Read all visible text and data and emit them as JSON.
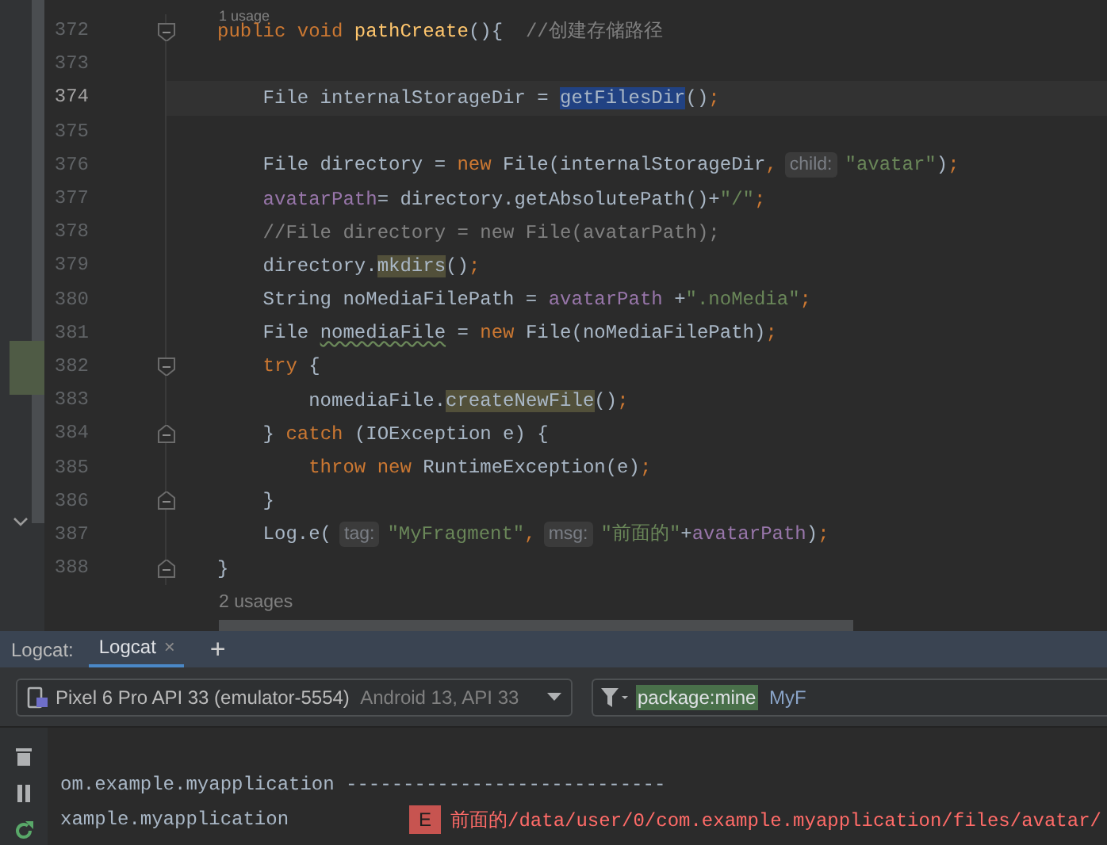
{
  "editor": {
    "usage_top": "1 usage",
    "lines": [
      {
        "number": "372",
        "current": false,
        "fold_start": true,
        "fold_end": false,
        "segments": [
          {
            "kind": "code",
            "tokens": [
              {
                "kind": "keyword",
                "text": "public void "
              },
              {
                "kind": "decl",
                "text": "pathCreate"
              },
              {
                "kind": "plain",
                "text": "(){  "
              },
              {
                "kind": "comment",
                "text": "//创建存储路径"
              }
            ]
          }
        ]
      },
      {
        "number": "373",
        "current": false,
        "fold_start": false,
        "fold_end": false
      },
      {
        "number": "374",
        "current": true,
        "fold_start": false,
        "fold_end": false,
        "segments": [
          {
            "kind": "code",
            "tokens": [
              {
                "kind": "plain",
                "text": "    File internalStorageDir = "
              },
              {
                "kind": "selected",
                "text": "getFilesDir"
              },
              {
                "kind": "plain",
                "text": "()"
              },
              {
                "kind": "keyword",
                "text": ";"
              }
            ]
          }
        ]
      },
      {
        "number": "375",
        "current": false,
        "fold_start": false,
        "fold_end": false
      },
      {
        "number": "376",
        "current": false,
        "fold_start": false,
        "fold_end": false,
        "segments": [
          {
            "kind": "code",
            "tokens": [
              {
                "kind": "plain",
                "text": "    File directory = "
              },
              {
                "kind": "keyword",
                "text": "new "
              },
              {
                "kind": "plain",
                "text": "File(internalStorageDir"
              },
              {
                "kind": "keyword",
                "text": ","
              }
            ]
          },
          {
            "kind": "hint",
            "text": "child:"
          },
          {
            "kind": "code",
            "tokens": [
              {
                "kind": "string",
                "text": "\"avatar\""
              },
              {
                "kind": "plain",
                "text": ")"
              },
              {
                "kind": "keyword",
                "text": ";"
              }
            ]
          }
        ]
      },
      {
        "number": "377",
        "current": false,
        "fold_start": false,
        "fold_end": false,
        "segments": [
          {
            "kind": "code",
            "tokens": [
              {
                "kind": "field",
                "text": "    avatarPath"
              },
              {
                "kind": "plain",
                "text": "= directory.getAbsolutePath()+"
              },
              {
                "kind": "string",
                "text": "\"/\""
              },
              {
                "kind": "keyword",
                "text": ";"
              }
            ]
          }
        ]
      },
      {
        "number": "378",
        "current": false,
        "fold_start": false,
        "fold_end": false,
        "segments": [
          {
            "kind": "code",
            "tokens": [
              {
                "kind": "comment",
                "text": "    //File directory = new File(avatarPath);"
              }
            ]
          }
        ]
      },
      {
        "number": "379",
        "current": false,
        "fold_start": false,
        "fold_end": false,
        "segments": [
          {
            "kind": "code",
            "tokens": [
              {
                "kind": "plain",
                "text": "    directory."
              },
              {
                "kind": "usage",
                "text": "mkdirs"
              },
              {
                "kind": "plain",
                "text": "()"
              },
              {
                "kind": "keyword",
                "text": ";"
              }
            ]
          }
        ]
      },
      {
        "number": "380",
        "current": false,
        "fold_start": false,
        "fold_end": false,
        "segments": [
          {
            "kind": "code",
            "tokens": [
              {
                "kind": "plain",
                "text": "    String noMediaFilePath = "
              },
              {
                "kind": "field",
                "text": "avatarPath "
              },
              {
                "kind": "plain",
                "text": "+"
              },
              {
                "kind": "string",
                "text": "\".noMedia\""
              },
              {
                "kind": "keyword",
                "text": ";"
              }
            ]
          }
        ]
      },
      {
        "number": "381",
        "current": false,
        "fold_start": false,
        "fold_end": false,
        "segments": [
          {
            "kind": "code",
            "tokens": [
              {
                "kind": "plain",
                "text": "    File "
              },
              {
                "kind": "typo",
                "text": "nomediaFile"
              },
              {
                "kind": "plain",
                "text": " = "
              },
              {
                "kind": "keyword",
                "text": "new "
              },
              {
                "kind": "plain",
                "text": "File(noMediaFilePath)"
              },
              {
                "kind": "keyword",
                "text": ";"
              }
            ]
          }
        ]
      },
      {
        "number": "382",
        "current": false,
        "fold_start": true,
        "fold_end": false,
        "segments": [
          {
            "kind": "code",
            "tokens": [
              {
                "kind": "keyword",
                "text": "    try "
              },
              {
                "kind": "plain",
                "text": "{"
              }
            ]
          }
        ]
      },
      {
        "number": "383",
        "current": false,
        "fold_start": false,
        "fold_end": false,
        "segments": [
          {
            "kind": "code",
            "tokens": [
              {
                "kind": "plain",
                "text": "        nomediaFile."
              },
              {
                "kind": "usage",
                "text": "createNewFile"
              },
              {
                "kind": "plain",
                "text": "()"
              },
              {
                "kind": "keyword",
                "text": ";"
              }
            ]
          }
        ]
      },
      {
        "number": "384",
        "current": false,
        "fold_start": false,
        "fold_end": true,
        "segments": [
          {
            "kind": "code",
            "tokens": [
              {
                "kind": "plain",
                "text": "    } "
              },
              {
                "kind": "keyword",
                "text": "catch "
              },
              {
                "kind": "plain",
                "text": "(IOException e) {"
              }
            ]
          }
        ]
      },
      {
        "number": "385",
        "current": false,
        "fold_start": false,
        "fold_end": false,
        "segments": [
          {
            "kind": "code",
            "tokens": [
              {
                "kind": "keyword",
                "text": "        throw new "
              },
              {
                "kind": "plain",
                "text": "RuntimeException(e)"
              },
              {
                "kind": "keyword",
                "text": ";"
              }
            ]
          }
        ]
      },
      {
        "number": "386",
        "current": false,
        "fold_start": false,
        "fold_end": true,
        "segments": [
          {
            "kind": "code",
            "tokens": [
              {
                "kind": "plain",
                "text": "    }"
              }
            ]
          }
        ]
      },
      {
        "number": "387",
        "current": false,
        "fold_start": false,
        "fold_end": false,
        "segments": [
          {
            "kind": "code",
            "tokens": [
              {
                "kind": "plain",
                "text": "    Log.e("
              }
            ]
          },
          {
            "kind": "hint",
            "text": "tag:"
          },
          {
            "kind": "code",
            "tokens": [
              {
                "kind": "string",
                "text": "\"MyFragment\""
              },
              {
                "kind": "keyword",
                "text": ","
              }
            ]
          },
          {
            "kind": "hint",
            "text": "msg:"
          },
          {
            "kind": "code",
            "tokens": [
              {
                "kind": "string",
                "text": "\"前面的\""
              },
              {
                "kind": "plain",
                "text": "+"
              },
              {
                "kind": "field",
                "text": "avatarPath"
              },
              {
                "kind": "plain",
                "text": ")"
              },
              {
                "kind": "keyword",
                "text": ";"
              }
            ]
          }
        ]
      },
      {
        "number": "388",
        "current": false,
        "fold_start": false,
        "fold_end": true,
        "segments": [
          {
            "kind": "code",
            "tokens": [
              {
                "kind": "plain",
                "text": "}"
              }
            ]
          }
        ]
      }
    ],
    "usage_bottom": "2 usages"
  },
  "logcat": {
    "title": "Logcat:",
    "tabs": [
      {
        "label": "Logcat",
        "selected": true,
        "close": "×"
      }
    ],
    "add_tab": "+",
    "device": {
      "name": "Pixel 6 Pro API 33 (emulator-5554)",
      "detail": "Android 13, API 33"
    },
    "filter": {
      "token": "package:mine",
      "text": "MyF"
    },
    "entries": [
      {
        "package": "om.example.myapplication ----------------------------"
      },
      {
        "package": "xample.myapplication",
        "level": "E",
        "message": "前面的/data/user/0/com.example.myapplication/files/avatar/"
      }
    ]
  }
}
